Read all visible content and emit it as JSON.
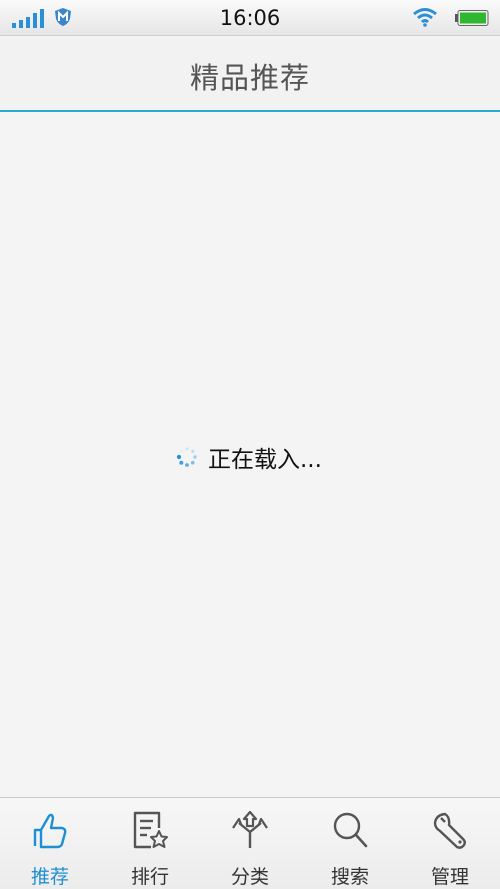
{
  "status_bar": {
    "time": "16:06",
    "signal_icon": "signal-bars-icon",
    "app_badge_icon": "shield-m-icon",
    "wifi_icon": "wifi-icon",
    "battery_icon": "battery-icon",
    "battery_color": "#2fb82f"
  },
  "header": {
    "title": "精品推荐",
    "accent_color": "#29a7d5"
  },
  "main": {
    "loading_text": "正在载入..."
  },
  "tab_bar": {
    "active_color": "#1e8fd0",
    "tabs": [
      {
        "label": "推荐",
        "icon": "thumbs-up-icon",
        "active": true
      },
      {
        "label": "排行",
        "icon": "ranking-list-icon",
        "active": false
      },
      {
        "label": "分类",
        "icon": "category-arrows-icon",
        "active": false
      },
      {
        "label": "搜索",
        "icon": "search-icon",
        "active": false
      },
      {
        "label": "管理",
        "icon": "wrench-icon",
        "active": false
      }
    ]
  }
}
